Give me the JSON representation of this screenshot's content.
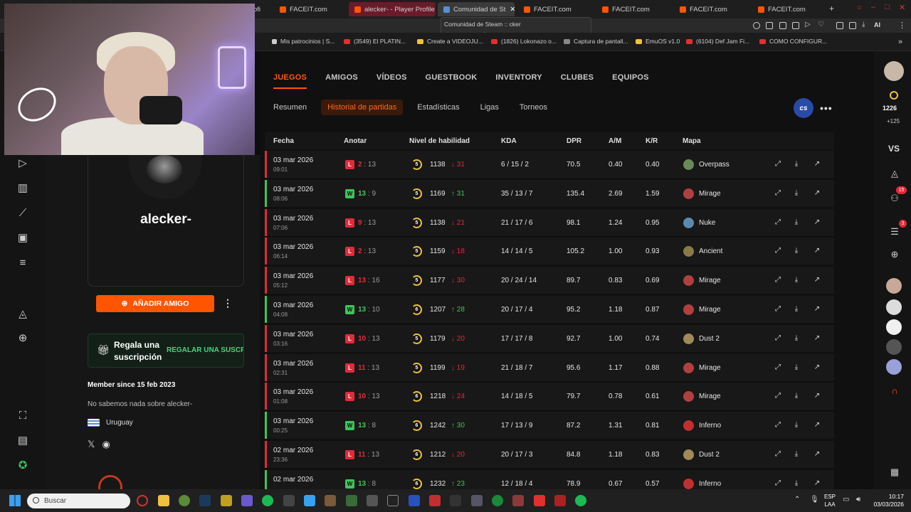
{
  "browser": {
    "tabs": [
      {
        "label": "ofi"
      },
      {
        "label": "FACEIT.com"
      },
      {
        "label": "alecker- - Player Profile -"
      },
      {
        "label": "Comunidad de St"
      },
      {
        "label": "FACEIT.com"
      },
      {
        "label": "FACEIT.com"
      },
      {
        "label": "FACEIT.com"
      },
      {
        "label": "FACEIT.com"
      }
    ],
    "tooltip": {
      "title": "Comunidad de Steam :: cker",
      "url": "steamcommunity.com"
    },
    "bookmarks": [
      {
        "label": "Mis patrocinios | S..."
      },
      {
        "label": "(3549) El PLATIN..."
      },
      {
        "label": "Create a VIDEOJU..."
      },
      {
        "label": "(1826) Lokonazo o..."
      },
      {
        "label": "Captura de pantall..."
      },
      {
        "label": "EmuOS v1.0"
      },
      {
        "label": "(6104) Def Jam Fi..."
      },
      {
        "label": "COMO CONFIGUR..."
      }
    ],
    "toolbar_ai": "AI"
  },
  "profile": {
    "username": "alecker-",
    "add_friend": "AÑADIR AMIGO",
    "gift_title": "Regala una suscripción",
    "gift_link": "REGALAR UNA SUSCRIPCIÓN",
    "member_since": "Member since 15 feb 2023",
    "about": "No sabemos nada sobre alecker-",
    "country": "Uruguay"
  },
  "nav": {
    "main": [
      "JUEGOS",
      "AMIGOS",
      "VÍDEOS",
      "GUESTBOOK",
      "INVENTORY",
      "CLUBES",
      "EQUIPOS"
    ],
    "sub": [
      "Resumen",
      "Historial de partidas",
      "Estadísticas",
      "Ligas",
      "Torneos"
    ],
    "game_badge": "cs"
  },
  "table": {
    "headers": {
      "fecha": "Fecha",
      "anotar": "Anotar",
      "nivel": "Nivel de habilidad",
      "kda": "KDA",
      "dpr": "DPR",
      "am": "A/M",
      "kr": "K/R",
      "mapa": "Mapa"
    },
    "rows": [
      {
        "date": "03 mar 2026",
        "time": "09:01",
        "result": "L",
        "mine": "2",
        "theirs": "13",
        "level": "5",
        "elo": "1138",
        "delta": "31",
        "kda": "6 / 15 / 2",
        "dpr": "70.5",
        "am": "0.40",
        "kr": "0.40",
        "map": "Overpass"
      },
      {
        "date": "03 mar 2026",
        "time": "08:06",
        "result": "W",
        "mine": "13",
        "theirs": "9",
        "level": "5",
        "elo": "1169",
        "delta": "31",
        "kda": "35 / 13 / 7",
        "dpr": "135.4",
        "am": "2.69",
        "kr": "1.59",
        "map": "Mirage"
      },
      {
        "date": "03 mar 2026",
        "time": "07:06",
        "result": "L",
        "mine": "9",
        "theirs": "13",
        "level": "5",
        "elo": "1138",
        "delta": "21",
        "kda": "21 / 17 / 6",
        "dpr": "98.1",
        "am": "1.24",
        "kr": "0.95",
        "map": "Nuke"
      },
      {
        "date": "03 mar 2026",
        "time": "06:14",
        "result": "L",
        "mine": "2",
        "theirs": "13",
        "level": "5",
        "elo": "1159",
        "delta": "18",
        "kda": "14 / 14 / 5",
        "dpr": "105.2",
        "am": "1.00",
        "kr": "0.93",
        "map": "Ancient"
      },
      {
        "date": "03 mar 2026",
        "time": "05:12",
        "result": "L",
        "mine": "13",
        "theirs": "16",
        "level": "5",
        "elo": "1177",
        "delta": "30",
        "kda": "20 / 24 / 14",
        "dpr": "89.7",
        "am": "0.83",
        "kr": "0.69",
        "map": "Mirage"
      },
      {
        "date": "03 mar 2026",
        "time": "04:08",
        "result": "W",
        "mine": "13",
        "theirs": "10",
        "level": "6",
        "elo": "1207",
        "delta": "28",
        "kda": "20 / 17 / 4",
        "dpr": "95.2",
        "am": "1.18",
        "kr": "0.87",
        "map": "Mirage"
      },
      {
        "date": "03 mar 2026",
        "time": "03:16",
        "result": "L",
        "mine": "10",
        "theirs": "13",
        "level": "5",
        "elo": "1179",
        "delta": "20",
        "kda": "17 / 17 / 8",
        "dpr": "92.7",
        "am": "1.00",
        "kr": "0.74",
        "map": "Dust 2"
      },
      {
        "date": "03 mar 2026",
        "time": "02:31",
        "result": "L",
        "mine": "11",
        "theirs": "13",
        "level": "5",
        "elo": "1199",
        "delta": "19",
        "kda": "21 / 18 / 7",
        "dpr": "95.6",
        "am": "1.17",
        "kr": "0.88",
        "map": "Mirage"
      },
      {
        "date": "03 mar 2026",
        "time": "01:08",
        "result": "L",
        "mine": "10",
        "theirs": "13",
        "level": "6",
        "elo": "1218",
        "delta": "24",
        "kda": "14 / 18 / 5",
        "dpr": "79.7",
        "am": "0.78",
        "kr": "0.61",
        "map": "Mirage"
      },
      {
        "date": "03 mar 2026",
        "time": "00:25",
        "result": "W",
        "mine": "13",
        "theirs": "8",
        "level": "6",
        "elo": "1242",
        "delta": "30",
        "kda": "17 / 13 / 9",
        "dpr": "87.2",
        "am": "1.31",
        "kr": "0.81",
        "map": "Inferno"
      },
      {
        "date": "02 mar 2026",
        "time": "23:36",
        "result": "L",
        "mine": "11",
        "theirs": "13",
        "level": "6",
        "elo": "1212",
        "delta": "20",
        "kda": "20 / 17 / 3",
        "dpr": "84.8",
        "am": "1.18",
        "kr": "0.83",
        "map": "Dust 2"
      },
      {
        "date": "02 mar 2026",
        "time": "",
        "result": "W",
        "mine": "13",
        "theirs": "8",
        "level": "6",
        "elo": "1232",
        "delta": "23",
        "kda": "12 / 18 / 4",
        "dpr": "78.9",
        "am": "0.67",
        "kr": "0.57",
        "map": "Inferno"
      }
    ]
  },
  "right_rail": {
    "points": "1226",
    "points_delta": "+125",
    "vs": "VS",
    "friends_badge": "15",
    "party_badge": "3"
  },
  "taskbar": {
    "search_placeholder": "Buscar",
    "lang_top": "ESP",
    "lang_bottom": "LAA",
    "time": "10:17",
    "date": "03/03/2026"
  },
  "colors": {
    "accent": "#ff5500",
    "win": "#3ec45a",
    "loss": "#e22a3a",
    "level": "#f0c23a"
  }
}
